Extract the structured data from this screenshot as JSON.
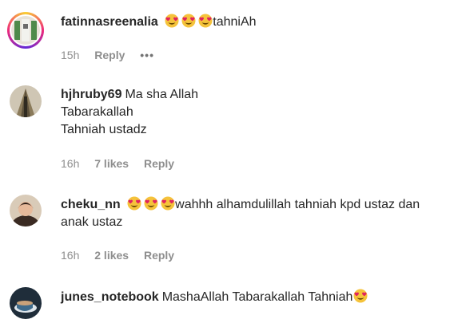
{
  "comments": [
    {
      "username": "fatinnasreenalia",
      "text": "tahniAh",
      "time": "15h",
      "reply": "Reply",
      "more": "•••"
    },
    {
      "username": "hjhruby69",
      "text_line1": "Ma sha Allah",
      "text_line2": "Tabarakallah",
      "text_line3": "Tahniah ustadz",
      "time": "16h",
      "likes": "7 likes",
      "reply": "Reply"
    },
    {
      "username": "cheku_nn",
      "text_line1": "wahhh alhamdulillah tahniah kpd ustaz dan",
      "text_line2": "anak ustaz",
      "time": "16h",
      "likes": "2 likes",
      "reply": "Reply"
    },
    {
      "username": "junes_notebook",
      "text": "MashaAllah Tabarakallah Tahniah"
    }
  ],
  "icons": {
    "emoji": "smiling-face-with-heart-eyes-icon",
    "emoji_color": "#f5c33b",
    "heart_color": "#e0245e"
  }
}
